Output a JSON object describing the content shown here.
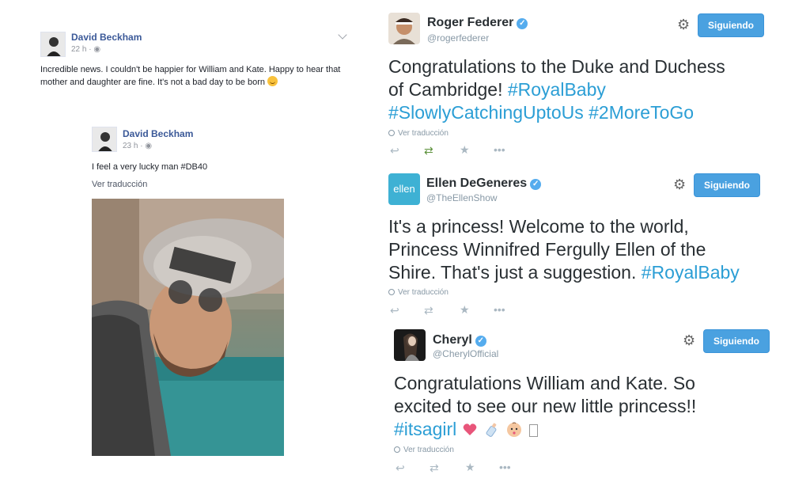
{
  "facebook": {
    "post1": {
      "author": "David Beckham",
      "time": "22 h",
      "text": "Incredible news. I couldn't be happier for William and Kate. Happy to hear that mother and daughter are fine. It's not a bad day to be born",
      "emoji": "winking-face-icon"
    },
    "post2": {
      "author": "David Beckham",
      "time": "23 h",
      "text": "I feel a very lucky man #DB40",
      "translate": "Ver traducción"
    }
  },
  "twitter": {
    "tweet1": {
      "name": "Roger Federer",
      "handle": "@rogerfederer",
      "follow_label": "Siguiendo",
      "line1": "Congratulations to the Duke and Duchess",
      "line2_text": "of Cambridge! ",
      "line2_tag": "#RoyalBaby",
      "line3": "#SlowlyCatchingUptoUs #2MoreToGo",
      "translate": "Ver traducción",
      "retweeted": true
    },
    "tweet2": {
      "name": "Ellen DeGeneres",
      "handle": "@TheEllenShow",
      "follow_label": "Siguiendo",
      "line1": "It's a princess! Welcome to the world,",
      "line2": "Princess Winnifred Fergully Ellen of the",
      "line3_text": "Shire. That's just a suggestion. ",
      "line3_tag": "#RoyalBaby",
      "translate": "Ver traducción",
      "avatar_text": "ellen"
    },
    "tweet3": {
      "name": "Cheryl",
      "handle": "@CherylOfficial",
      "follow_label": "Siguiendo",
      "line1": "Congratulations William and Kate. So",
      "line2": "excited to see our new little princess!!",
      "line3_tag": "#itsagirl",
      "emojis": [
        "heart-icon",
        "baby-bottle-icon",
        "baby-face-icon"
      ],
      "translate": "Ver traducción"
    }
  },
  "colors": {
    "fb_blue": "#3b5998",
    "tw_blue": "#4aa1e0",
    "hashtag": "#2b9ed5",
    "retweet_green": "#5c913b"
  }
}
